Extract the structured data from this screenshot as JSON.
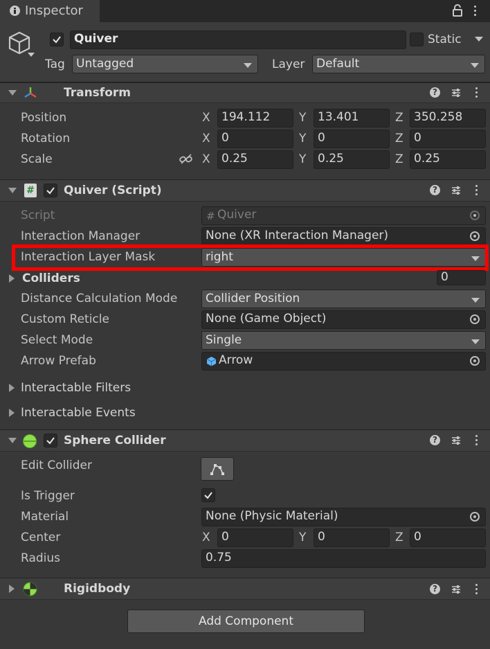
{
  "window": {
    "tab_label": "Inspector"
  },
  "object": {
    "name": "Quiver",
    "static_label": "Static",
    "tag_label": "Tag",
    "tag_value": "Untagged",
    "layer_label": "Layer",
    "layer_value": "Default"
  },
  "transform": {
    "title": "Transform",
    "rows": [
      {
        "label": "Position",
        "x": "194.112",
        "y": "13.401",
        "z": "350.258"
      },
      {
        "label": "Rotation",
        "x": "0",
        "y": "0",
        "z": "0"
      },
      {
        "label": "Scale",
        "x": "0.25",
        "y": "0.25",
        "z": "0.25"
      }
    ]
  },
  "axes": {
    "x": "X",
    "y": "Y",
    "z": "Z"
  },
  "quiver_script": {
    "title": "Quiver (Script)",
    "script_label": "Script",
    "script_value": "Quiver",
    "interaction_manager_label": "Interaction Manager",
    "interaction_manager_value": "None (XR Interaction Manager)",
    "layer_mask_label": "Interaction Layer Mask",
    "layer_mask_value": "right",
    "colliders_label": "Colliders",
    "colliders_value": "0",
    "distance_mode_label": "Distance Calculation Mode",
    "distance_mode_value": "Collider Position",
    "custom_reticle_label": "Custom Reticle",
    "custom_reticle_value": "None (Game Object)",
    "select_mode_label": "Select Mode",
    "select_mode_value": "Single",
    "arrow_prefab_label": "Arrow Prefab",
    "arrow_prefab_value": "Arrow",
    "filters_label": "Interactable Filters",
    "events_label": "Interactable Events"
  },
  "sphere_collider": {
    "title": "Sphere Collider",
    "edit_collider_label": "Edit Collider",
    "is_trigger_label": "Is Trigger",
    "material_label": "Material",
    "material_value": "None (Physic Material)",
    "center_label": "Center",
    "center_x": "0",
    "center_y": "0",
    "center_z": "0",
    "radius_label": "Radius",
    "radius_value": "0.75"
  },
  "rigidbody": {
    "title": "Rigidbody"
  },
  "footer": {
    "add_component_label": "Add Component"
  },
  "colors": {
    "highlight": "#ff0000",
    "panel": "#383838",
    "header": "#3e3e3e"
  }
}
